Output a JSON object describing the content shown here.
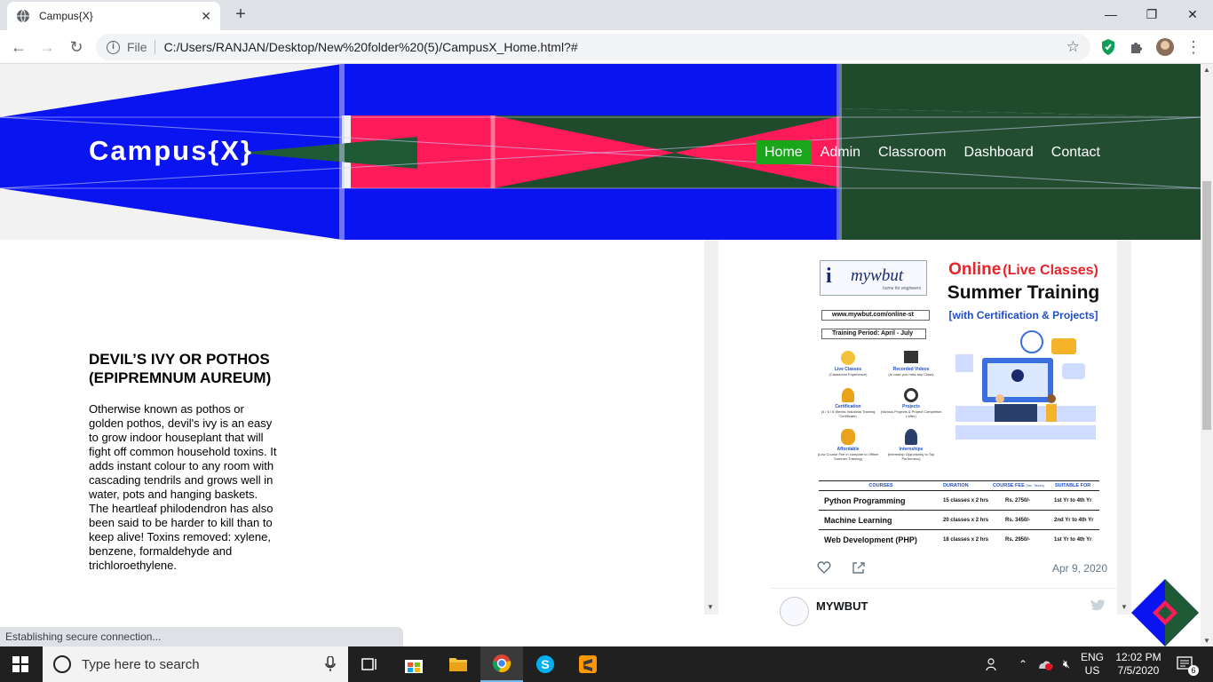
{
  "browser": {
    "tab_title": "Campus{X}",
    "tab_close": "✕",
    "new_tab": "+",
    "window_controls": {
      "minimize": "—",
      "maximize": "❐",
      "close": "✕"
    },
    "nav": {
      "back": "←",
      "forward": "→",
      "reload": "↻"
    },
    "address": {
      "info_glyph": "i",
      "scheme_label": "File",
      "url": "C:/Users/RANJAN/Desktop/New%20folder%20(5)/CampusX_Home.html?#"
    },
    "status_text": "Establishing secure connection..."
  },
  "site": {
    "brand": "Campus{X}",
    "nav_items": [
      {
        "label": "Home",
        "active": true
      },
      {
        "label": "Admin",
        "active": false
      },
      {
        "label": "Classroom",
        "active": false
      },
      {
        "label": "Dashboard",
        "active": false
      },
      {
        "label": "Contact",
        "active": false
      }
    ],
    "article": {
      "heading": "DEVIL’S IVY OR POTHOS (EPIPREMNUM AUREUM)",
      "body": "Otherwise known as pothos or golden pothos, devil's ivy is an easy to grow indoor houseplant that will fight off common household toxins. It adds instant colour to any room with cascading tendrils and grows well in water, pots and hanging baskets. The heartleaf philodendron has also been said to be harder to kill than to keep alive! Toxins removed: xylene, benzene, formaldehyde and trichloroethylene."
    },
    "tweet": {
      "ad": {
        "logo_text": "mywbut",
        "logo_tagline": "home for engineers",
        "headline_1a": "Online",
        "headline_1b": "(Live Classes)",
        "headline_2": "Summer Training",
        "headline_3": "[with Certification & Projects]",
        "website": "www.mywbut.com/online-st",
        "period": "Training Period: April - July",
        "features": [
          {
            "title": "Live Classes",
            "sub": "(Classroom Experience)"
          },
          {
            "title": "Recorded Videos",
            "sub": "(In case you miss any Class)"
          },
          {
            "title": "Certification",
            "sub": "(4 / 6 / 8 Weeks Industrial Training Certificate)"
          },
          {
            "title": "Projects",
            "sub": "(Various Projects & Project Completion Letter)"
          },
          {
            "title": "Affordable",
            "sub": "(Low Course Fee in compare to Offline Summer Training)"
          },
          {
            "title": "Internships",
            "sub": "(Internship Opportunity to Top Performers)"
          }
        ],
        "table_headers": [
          "COURSES",
          "DURATION",
          "COURSE FEE",
          "SUITABLE FOR"
        ],
        "fee_note": "(Inc. Taxes)",
        "courses": [
          {
            "name": "Python Programming",
            "duration": "15 classes x 2 hrs",
            "fee": "Rs. 2750/-",
            "suitable": "1st Yr to 4th Yr"
          },
          {
            "name": "Machine Learning",
            "duration": "20 classes x 2 hrs",
            "fee": "Rs. 3450/-",
            "suitable": "2nd Yr to 4th Yr"
          },
          {
            "name": "Web Development (PHP)",
            "duration": "18 classes x 2 hrs",
            "fee": "Rs. 2950/-",
            "suitable": "1st Yr to 4th Yr"
          }
        ]
      },
      "date": "Apr 9, 2020",
      "next_author": "MYWBUT"
    }
  },
  "taskbar": {
    "search_placeholder": "Type here to search",
    "tray": {
      "lang_1": "ENG",
      "lang_2": "US",
      "time": "12:02 PM",
      "date": "7/5/2020",
      "notif_count": "6"
    }
  },
  "colors": {
    "nav_active": "#1aa51a",
    "banner_blue": "#0a14f0",
    "banner_pink": "#ff1a5a",
    "banner_green": "#1f4a2c",
    "chrome_tabbar": "#dee1e6"
  }
}
